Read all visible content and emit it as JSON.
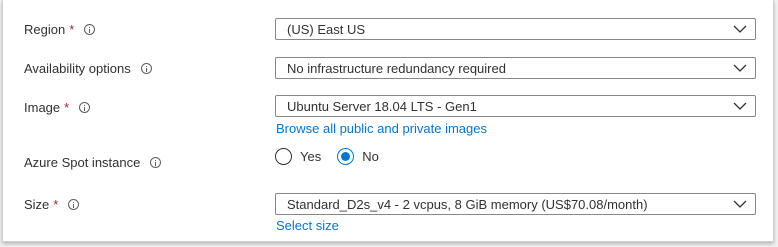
{
  "form": {
    "region": {
      "label": "Region",
      "required": "*",
      "value": "(US) East US"
    },
    "availability": {
      "label": "Availability options",
      "value": "No infrastructure redundancy required"
    },
    "image": {
      "label": "Image",
      "required": "*",
      "value": "Ubuntu Server 18.04 LTS - Gen1",
      "link": "Browse all public and private images"
    },
    "spot": {
      "label": "Azure Spot instance",
      "options": [
        "Yes",
        "No"
      ],
      "selected": "No"
    },
    "size": {
      "label": "Size",
      "required": "*",
      "value": "Standard_D2s_v4 - 2 vcpus, 8 GiB memory (US$70.08/month)",
      "link": "Select size"
    }
  },
  "icons": [
    "info-icon",
    "chevron-down-icon"
  ],
  "colors": {
    "accent": "#0078d4",
    "required": "#a4262c",
    "text": "#323130"
  }
}
